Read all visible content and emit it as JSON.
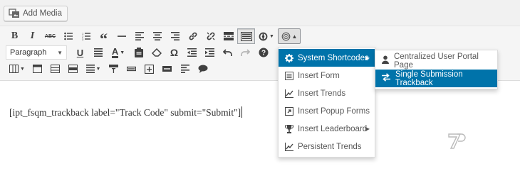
{
  "media": {
    "add_media_label": "Add Media"
  },
  "toolbar": {
    "format_select_value": "Paragraph",
    "row1_icons": [
      "bold-icon",
      "italic-icon",
      "strikethrough-icon",
      "bullet-list-icon",
      "numbered-list-icon",
      "blockquote-icon",
      "horizontal-line-icon",
      "align-left-icon",
      "align-center-icon",
      "align-right-icon",
      "link-icon",
      "unlink-icon",
      "read-more-icon",
      "toolbar-toggle-icon",
      "shortcode-icon",
      "fsqm-icon"
    ],
    "row2_icons": [
      "underline-icon",
      "justify-icon",
      "text-color-icon",
      "paste-text-icon",
      "clear-formatting-icon",
      "special-character-icon",
      "outdent-icon",
      "indent-icon",
      "undo-icon",
      "redo-icon",
      "help-icon"
    ],
    "row3_icons": [
      "table-icon",
      "row-properties-icon",
      "cell-properties-icon",
      "merge-icon",
      "table-menu-icon",
      "insert-before-icon",
      "delete-row-icon",
      "add-row-icon",
      "horizontal-rule-icon",
      "format-icon",
      "comment-icon"
    ]
  },
  "editor": {
    "content_text": "[ipt_fsqm_trackback label=\"Track Code\" submit=\"Submit\"]"
  },
  "menu": {
    "items": [
      {
        "label": "System Shortcodes",
        "icon": "gear-icon",
        "has_submenu": true,
        "highlighted": true
      },
      {
        "label": "Insert Form",
        "icon": "form-icon",
        "has_submenu": false,
        "highlighted": false
      },
      {
        "label": "Insert Trends",
        "icon": "trend-chart-icon",
        "has_submenu": false,
        "highlighted": false
      },
      {
        "label": "Insert Popup Forms",
        "icon": "popup-icon",
        "has_submenu": false,
        "highlighted": false
      },
      {
        "label": "Insert Leaderboard",
        "icon": "trophy-icon",
        "has_submenu": true,
        "highlighted": false
      },
      {
        "label": "Persistent Trends",
        "icon": "trend-chart-icon",
        "has_submenu": false,
        "highlighted": false
      }
    ]
  },
  "submenu": {
    "items": [
      {
        "label": "Centralized User Portal Page",
        "icon": "user-icon",
        "highlighted": false
      },
      {
        "label": "Single Submission Trackback",
        "icon": "exchange-icon",
        "highlighted": true
      }
    ]
  },
  "colors": {
    "accent": "#0073aa",
    "toolbar_bg": "#f5f5f5",
    "page_bg": "#f1f1f1"
  }
}
